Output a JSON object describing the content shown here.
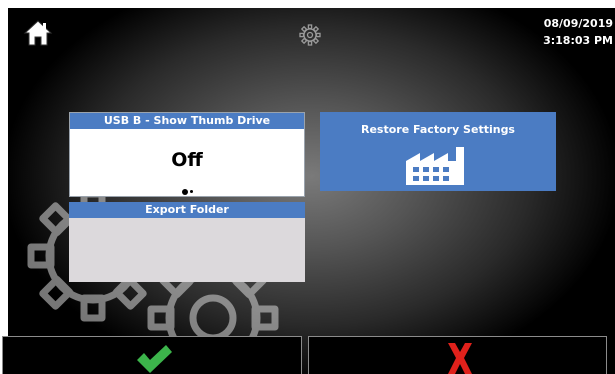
{
  "header": {
    "home_icon": "home-icon",
    "settings_icon": "gear-icon",
    "date": "08/09/2019",
    "time": "3:18:03 PM"
  },
  "tiles": {
    "usb": {
      "title": "USB B - Show Thumb Drive",
      "value": "Off",
      "page_indicator": {
        "count": 2,
        "active": 1
      }
    },
    "export": {
      "title": "Export Folder"
    },
    "restore": {
      "title": "Restore Factory Settings",
      "icon": "factory-icon"
    }
  },
  "footer": {
    "confirm_icon": "checkmark-icon",
    "cancel_icon": "x-icon"
  },
  "colors": {
    "tile_blue": "#4b7cc3",
    "confirm_green": "#3cb44b",
    "cancel_red": "#e0211b"
  }
}
